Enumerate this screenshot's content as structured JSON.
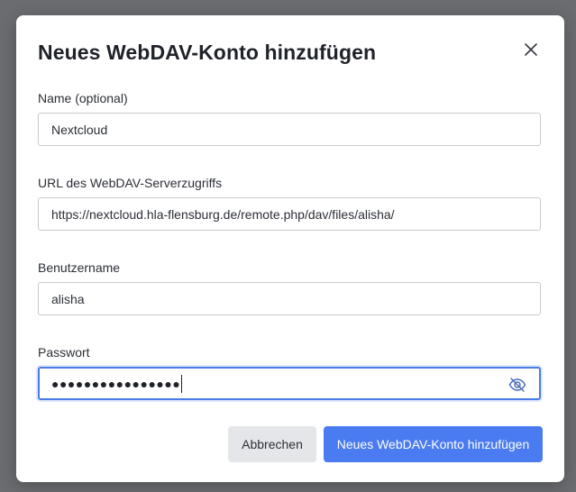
{
  "dialog": {
    "title": "Neues WebDAV-Konto hinzufügen",
    "close_icon": "close-icon"
  },
  "fields": {
    "name": {
      "label": "Name (optional)",
      "value": "Nextcloud"
    },
    "url": {
      "label": "URL des WebDAV-Serverzugriffs",
      "value": "https://nextcloud.hla-flensburg.de/remote.php/dav/files/alisha/"
    },
    "username": {
      "label": "Benutzername",
      "value": "alisha"
    },
    "password": {
      "label": "Passwort",
      "masked_value": "●●●●●●●●●●●●●●●●",
      "toggle_icon": "eye-slash-icon"
    }
  },
  "buttons": {
    "cancel_label": "Abbrechen",
    "submit_label": "Neues WebDAV-Konto hinzufügen"
  },
  "colors": {
    "primary": "#4a7bf0",
    "focus_border": "#4a7be8",
    "overlay": "#6b6c70"
  }
}
